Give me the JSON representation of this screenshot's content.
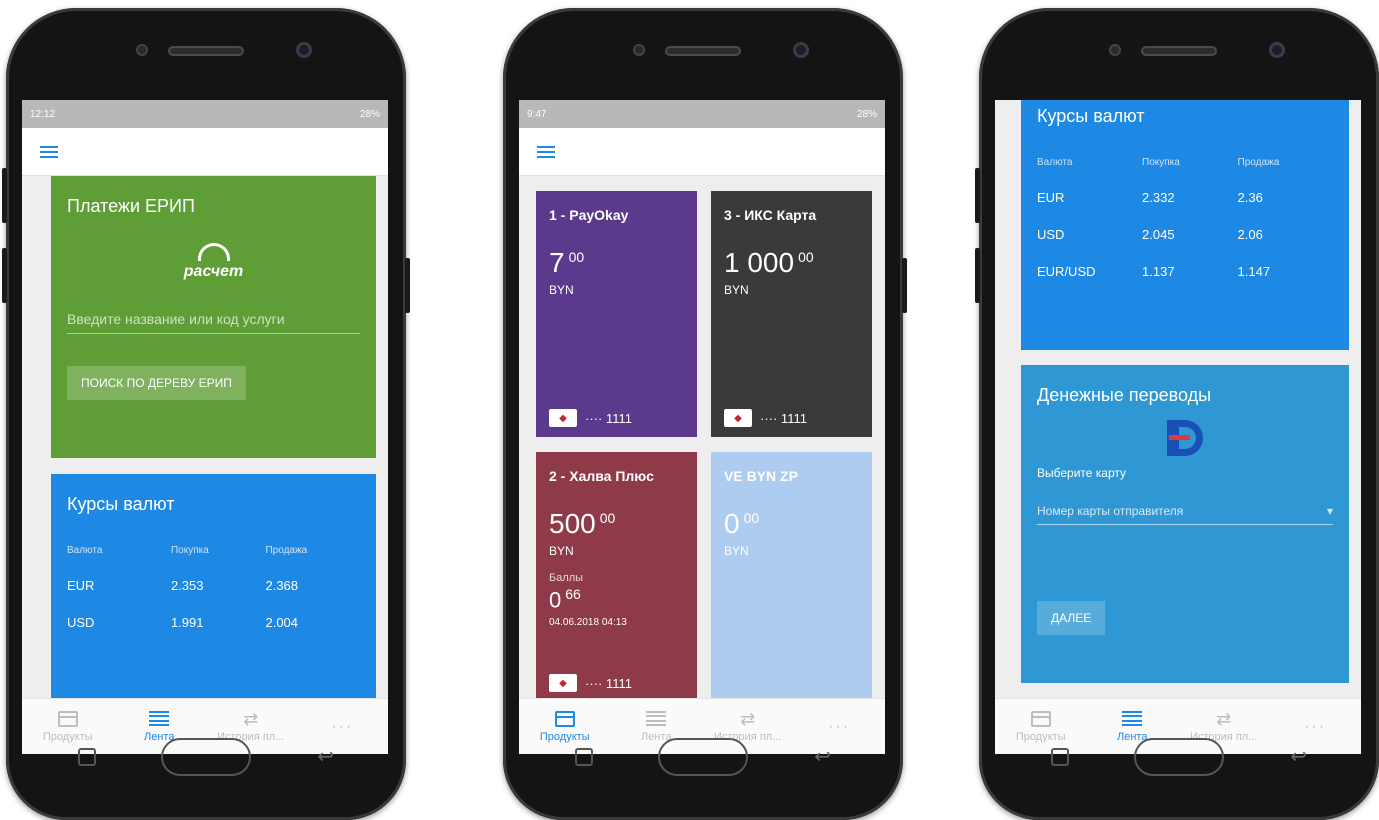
{
  "colors": {
    "primary": "#1e88e5",
    "erip_green": "#5f9e37",
    "transfers_teal": "#2f98d4"
  },
  "phone1": {
    "status": {
      "time": "12:12",
      "battery": "28%"
    },
    "erip": {
      "title": "Платежи ЕРИП",
      "logo_text": "расчет",
      "search_placeholder": "Введите название или код услуги",
      "tree_button": "ПОИСК ПО ДЕРЕВУ ЕРИП"
    },
    "rates": {
      "title": "Курсы валют",
      "headers": [
        "Валюта",
        "Покупка",
        "Продажа"
      ],
      "rows": [
        [
          "EUR",
          "2.353",
          "2.368"
        ],
        [
          "USD",
          "1.991",
          "2.004"
        ]
      ]
    },
    "nav": [
      "Продукты",
      "Лента",
      "История пл..."
    ]
  },
  "phone2": {
    "status": {
      "time": "9:47",
      "battery": "28%"
    },
    "products": [
      {
        "name": "1 - PayOkay",
        "amount": "7",
        "cents": "00",
        "currency": "BYN",
        "mask": "···· 1111",
        "color": "#5b3a8e"
      },
      {
        "name": "3 - ИКС Карта",
        "amount": "1 000",
        "cents": "00",
        "currency": "BYN",
        "mask": "···· 1111",
        "color": "#3a3a3a"
      },
      {
        "name": "2 - Халва Плюс",
        "amount": "500",
        "cents": "00",
        "currency": "BYN",
        "points_label": "Баллы",
        "points": "0",
        "points_cents": "66",
        "date": "04.06.2018 04:13",
        "mask": "···· 1111",
        "color": "#8e3a48"
      },
      {
        "name": "VE BYN ZP",
        "amount": "0",
        "cents": "00",
        "currency": "BYN",
        "color": "#aecbf0"
      }
    ],
    "nav": [
      "Продукты",
      "Лента",
      "История пл..."
    ]
  },
  "phone3": {
    "rates": {
      "title": "Курсы валют",
      "headers": [
        "Валюта",
        "Покупка",
        "Продажа"
      ],
      "rows": [
        [
          "EUR",
          "2.332",
          "2.36"
        ],
        [
          "USD",
          "2.045",
          "2.06"
        ],
        [
          "EUR/USD",
          "1.137",
          "1.147"
        ]
      ]
    },
    "transfers": {
      "title": "Денежные переводы",
      "select_label": "Выберите карту",
      "select_placeholder": "Номер карты отправителя",
      "next_button": "ДАЛЕЕ"
    },
    "nav": [
      "Продукты",
      "Лента",
      "История пл..."
    ]
  }
}
